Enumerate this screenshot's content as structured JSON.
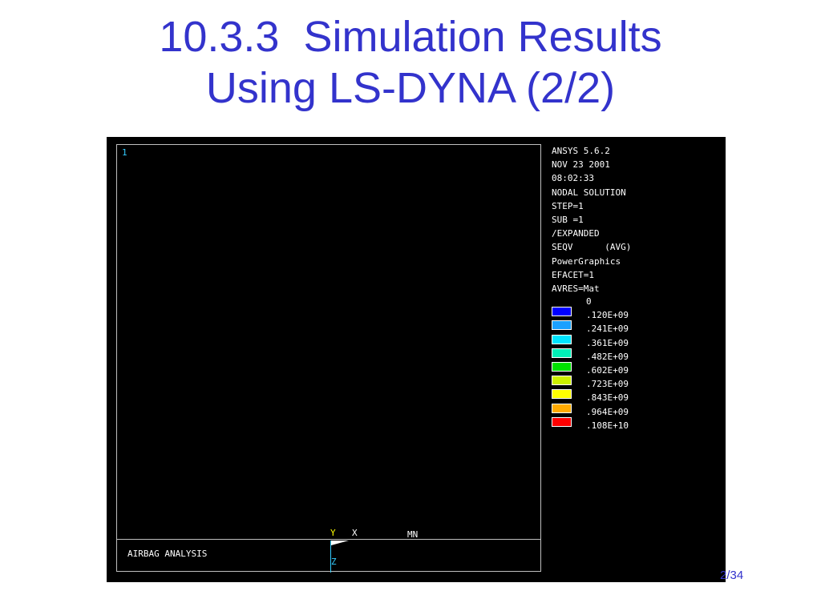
{
  "slide": {
    "title_lines": [
      "10.3.3  Simulation Results",
      "Using LS-DYNA (2/2)"
    ],
    "page_number": "2/34"
  },
  "viewport": {
    "window_number": "1",
    "caption": "AIRBAG ANALYSIS",
    "triad": {
      "y_label": "Y",
      "x_label": "X",
      "mn_label": "MN",
      "z_label": "Z"
    }
  },
  "info_panel": {
    "lines": [
      "ANSYS 5.6.2",
      "NOV 23 2001",
      "08:02:33",
      "NODAL SOLUTION",
      "STEP=1",
      "SUB =1",
      "/EXPANDED",
      "SEQV      (AVG)",
      "PowerGraphics",
      "EFACET=1",
      "AVRES=Mat"
    ]
  },
  "legend": {
    "zero_label": "0",
    "items": [
      {
        "label": ".120E+09",
        "color": "#0000ff"
      },
      {
        "label": ".241E+09",
        "color": "#1aa0ff"
      },
      {
        "label": ".361E+09",
        "color": "#00e5ff"
      },
      {
        "label": ".482E+09",
        "color": "#00f0b8"
      },
      {
        "label": ".602E+09",
        "color": "#00e000"
      },
      {
        "label": ".723E+09",
        "color": "#ccf000"
      },
      {
        "label": ".843E+09",
        "color": "#ffff00"
      },
      {
        "label": ".964E+09",
        "color": "#ffaa00"
      },
      {
        "label": ".108E+10",
        "color": "#ff0000"
      }
    ]
  }
}
